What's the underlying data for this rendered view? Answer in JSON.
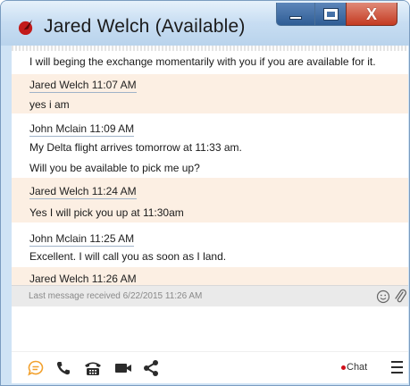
{
  "window": {
    "title": "Jared Welch (Available)",
    "close_glyph": "X"
  },
  "messages": [
    {
      "sender": "",
      "time": "",
      "lines": [
        "I will beging the exchange momentarily with you if you are available for it."
      ],
      "highlight": false
    },
    {
      "sender": "Jared Welch",
      "time": "11:07 AM",
      "header": "Jared Welch 11:07 AM",
      "lines": [
        "yes i am"
      ],
      "highlight": true
    },
    {
      "sender": "John Mclain",
      "time": "11:09 AM",
      "header": "John Mclain 11:09 AM",
      "lines": [
        "My Delta flight arrives tomorrow at 11:33 am.",
        "Will you be available to pick me up?"
      ],
      "highlight": false
    },
    {
      "sender": "Jared Welch",
      "time": "11:24 AM",
      "header": "Jared Welch 11:24 AM",
      "lines": [
        "Yes I will pick you up at 11:30am"
      ],
      "highlight": true
    },
    {
      "sender": "John Mclain",
      "time": "11:25 AM",
      "header": "John Mclain 11:25 AM",
      "lines": [
        "Excellent. I will call you as soon as I land."
      ],
      "highlight": false
    },
    {
      "sender": "Jared Welch",
      "time": "11:26 AM",
      "header": "Jared Welch 11:26 AM",
      "lines": [],
      "highlight": true
    }
  ],
  "status": {
    "last_message": "Last message received 6/22/2015 11:26 AM"
  },
  "compose": {
    "value": ""
  },
  "toolbar": {
    "icons": [
      "chat-bubble-icon",
      "phone-icon",
      "desk-phone-icon",
      "video-camera-icon",
      "share-icon"
    ],
    "chat_status": "Chat",
    "chat_status_color": "#d0101a"
  },
  "colors": {
    "highlight_row": "#fcefe3",
    "accent_orange": "#f2a12e",
    "titlebar": "#c7ddf2"
  }
}
